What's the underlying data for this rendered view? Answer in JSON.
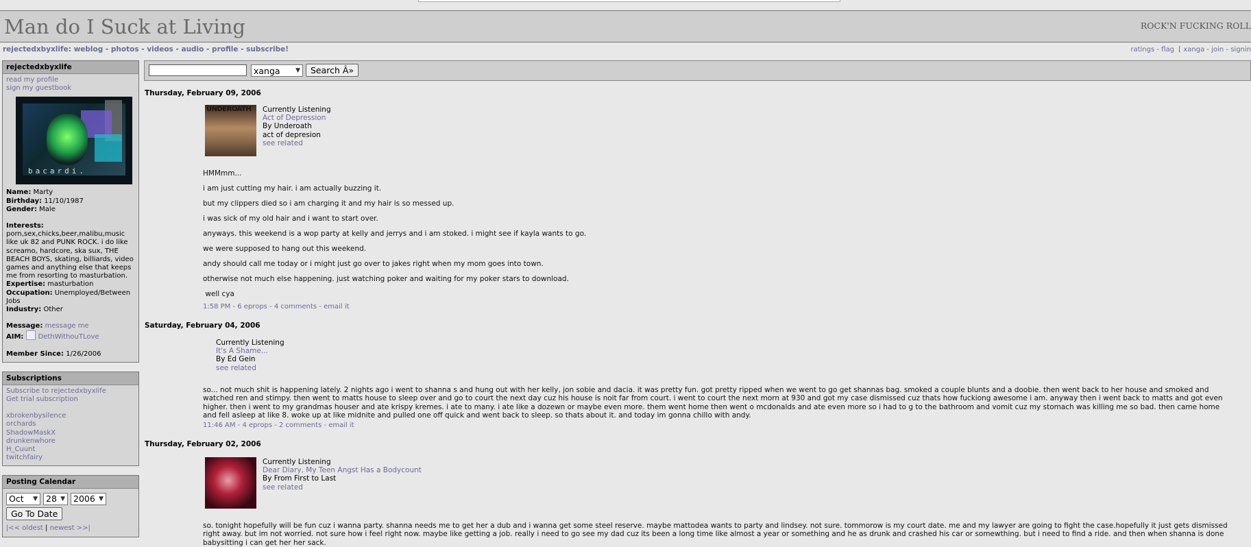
{
  "site": {
    "title": "Man do I Suck at Living",
    "tagline": "ROCK'N FUCKING ROLL"
  },
  "nav": {
    "username": "rejectedxbyxlife",
    "colon": ":",
    "items": [
      "weblog",
      "photos",
      "videos",
      "audio",
      "profile",
      "subscribe!"
    ]
  },
  "rightnav": {
    "ratings": "ratings",
    "flag": "flag",
    "xanga": "xanga",
    "join": "join",
    "signin": "signin"
  },
  "search": {
    "input_value": "",
    "select_value": "xanga",
    "button_label": "Search Â»"
  },
  "profile": {
    "module_title": "rejectedxbyxlife",
    "read_profile": "read my profile",
    "sign_guestbook": "sign my guestbook",
    "avatar_text": "bacardi.",
    "name_label": "Name:",
    "name": "Marty",
    "birthday_label": "Birthday:",
    "birthday": "11/10/1987",
    "gender_label": "Gender:",
    "gender": "Male",
    "interests_label": "Interests:",
    "interests": "porn,sex,chicks,beer,malibu,music like uk 82 and PUNK ROCK. i do like screamo, hardcore, ska sux, THE BEACH BOYS, skating, billiards, video games and anything else that keeps me from resorting to masturbation.",
    "expertise_label": "Expertise:",
    "expertise": "masturbation",
    "occupation_label": "Occupation:",
    "occupation": "Unemployed/Between Jobs",
    "industry_label": "Industry:",
    "industry": "Other",
    "message_label": "Message:",
    "message_link": "message me",
    "aim_label": "AIM:",
    "aim": "DethWithouTLove",
    "member_since_label": "Member Since:",
    "member_since": "1/26/2006"
  },
  "subscriptions": {
    "title": "Subscriptions",
    "subscribe": "Subscribe to rejectedxbyxlife",
    "trial": "Get trial subscription",
    "users": [
      "xbrokenbysilence",
      "orchards",
      "ShadowMaskX",
      "drunkenwhore",
      "H_Cuunt",
      "twitchfairy"
    ]
  },
  "calendar": {
    "title": "Posting Calendar",
    "month": "Oct",
    "day": "28",
    "year": "2006",
    "go_button": "Go To Date",
    "oldest": "|<< oldest",
    "separator": "|",
    "newest": "newest >>|"
  },
  "entries": [
    {
      "date": "Thursday, February 09, 2006",
      "listening_label": "Currently Listening",
      "track": "Act of Depression",
      "artist": "By Underoath",
      "album": "act of depresion",
      "see_related": "see related",
      "paragraphs": [
        "HMMmm...",
        "i am just cutting my hair. i am actually buzzing it.",
        "but my clippers died so i am charging it and my hair is so messed up.",
        "i was sick of my old hair and i want to start over.",
        "anyways. this weekend is a wop party at kelly and jerrys and i am stoked. i might see if kayla wants to go.",
        "we were supposed to hang out this weekend.",
        "andy should call me today or i might just go over to jakes right when my mom goes into town.",
        "otherwise not much else happening. just watching poker and waiting for my poker stars to download.",
        " well cya"
      ],
      "time": "1:58 PM",
      "eprops": "6 eprops",
      "comments": "4 comments",
      "email": "email it"
    },
    {
      "date": "Saturday, February 04, 2006",
      "listening_label": "Currently Listening",
      "track": "It's A Shame...",
      "artist": "By Ed Gein",
      "see_related": "see related",
      "body": "so... not  much shit is happening lately. 2 nights ago i went to shanna s and hung out with her kelly, jon sobie and dacia. it was pretty fun. got pretty ripped when we went to go get shannas bag. smoked a couple blunts and a doobie. then went back to her house and smoked and watched ren and stimpy. then went to matts house to sleep over and go to court the next day cuz his house is noit far from court. i went to court the next morn at 930 and got my case dismissed cuz thats how fuckiong awesome i am. anyway then i went back to matts and got even higher. then i went to my grandmas houser and ate krispy kremes. i ate to many. i ate like a dozewn or maybe even more. them went home then went o mcdonalds and ate even more so i had to g to the bathroom and vomit cuz my stomach was killing me so bad. then came home and fell asleep at like 8. woke up at like midnite and pulled one off quick and went back to sleep. so thats about it. and today im gonna chillo with andy.",
      "time": "11:46 AM",
      "eprops": "4 eprops",
      "comments": "2 comments",
      "email": "email it"
    },
    {
      "date": "Thursday, February 02, 2006",
      "listening_label": "Currently Listening",
      "track": "Dear Diary, My Teen Angst Has a Bodycount",
      "artist": "By From First to Last",
      "see_related": "see related",
      "body": "so. tonight hopefully will be fun cuz i wanna party. shanna needs me to get her a dub and i wanna get some steel reserve. maybe mattodea wants to party and lindsey. not sure. tommorow is my court date. me and my lawyer are going to fight the case.hopefully it just gets dismissed right away. but im not worried. not sure how i feel right now. maybe like getting a job. really i need to go see my dad cuz its been a long time like almost a year or something and he as drunk and crashed his car or somewthing. but i need to find a ride. and then when shanna is done babysitting i can get her her sack."
    }
  ]
}
